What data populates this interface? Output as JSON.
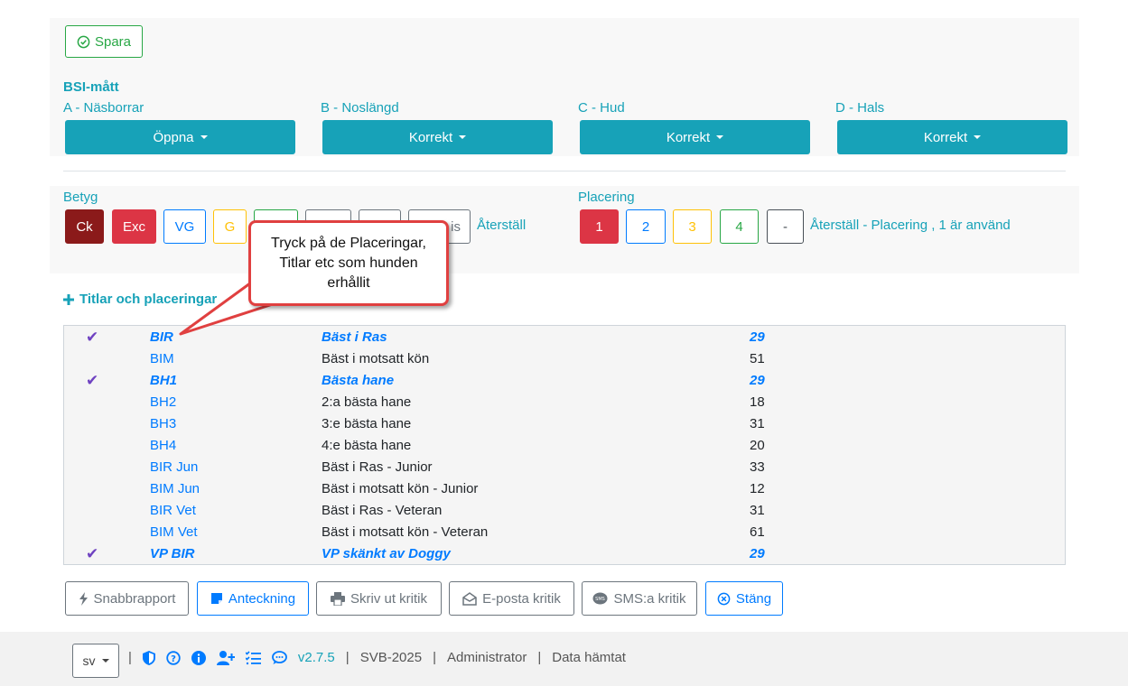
{
  "toolbar": {
    "save_label": "Spara"
  },
  "bsi": {
    "title": "BSI-mått",
    "fields": [
      {
        "label": "A - Näsborrar",
        "value": "Öppna"
      },
      {
        "label": "B - Noslängd",
        "value": "Korrekt"
      },
      {
        "label": "C - Hud",
        "value": "Korrekt"
      },
      {
        "label": "D - Hals",
        "value": "Korrekt"
      }
    ]
  },
  "grading": {
    "label": "Betyg",
    "buttons": [
      "Ck",
      "Exc",
      "VG",
      "G",
      "",
      "",
      "",
      "is"
    ],
    "reset": "Återställ"
  },
  "placement": {
    "label": "Placering",
    "buttons": [
      "1",
      "2",
      "3",
      "4",
      "-"
    ],
    "reset": "Återställ - Placering , 1 är använd"
  },
  "callout": {
    "text": "Tryck på de Placeringar, Titlar etc som hunden erhållit"
  },
  "titles": {
    "label": "Titlar och placeringar",
    "rows": [
      {
        "code": "BIR",
        "desc": "Bäst i Ras",
        "num": "29",
        "selected": true
      },
      {
        "code": "BIM",
        "desc": "Bäst i motsatt kön",
        "num": "51",
        "selected": false
      },
      {
        "code": "BH1",
        "desc": "Bästa hane",
        "num": "29",
        "selected": true
      },
      {
        "code": "BH2",
        "desc": "2:a bästa hane",
        "num": "18",
        "selected": false
      },
      {
        "code": "BH3",
        "desc": "3:e bästa hane",
        "num": "31",
        "selected": false
      },
      {
        "code": "BH4",
        "desc": "4:e bästa hane",
        "num": "20",
        "selected": false
      },
      {
        "code": "BIR Jun",
        "desc": "Bäst i Ras - Junior",
        "num": "33",
        "selected": false
      },
      {
        "code": "BIM Jun",
        "desc": "Bäst i motsatt kön - Junior",
        "num": "12",
        "selected": false
      },
      {
        "code": "BIR Vet",
        "desc": "Bäst i Ras - Veteran",
        "num": "31",
        "selected": false
      },
      {
        "code": "BIM Vet",
        "desc": "Bäst i motsatt kön - Veteran",
        "num": "61",
        "selected": false
      },
      {
        "code": "VP BIR",
        "desc": "VP skänkt av Doggy",
        "num": "29",
        "selected": true
      }
    ]
  },
  "actions": {
    "quick_report": "Snabbrapport",
    "note": "Anteckning",
    "print": "Skriv ut kritik",
    "email": "E-posta kritik",
    "sms": "SMS:a kritik",
    "close": "Stäng"
  },
  "footer": {
    "lang": "sv",
    "version": "v2.7.5",
    "event": "SVB-2025",
    "user": "Administrator",
    "data": "Data hämtat"
  }
}
